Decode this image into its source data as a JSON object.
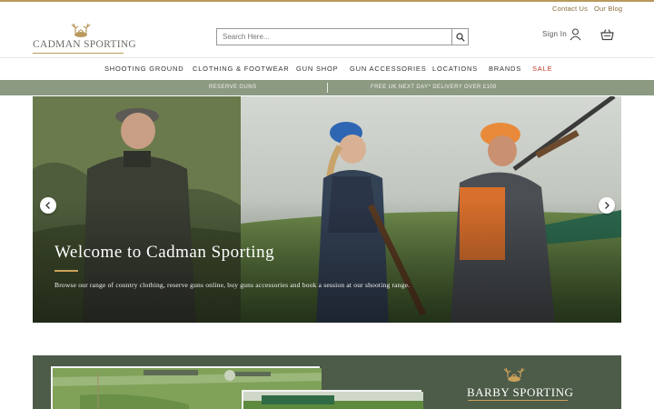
{
  "top_links": {
    "contact": "Contact Us",
    "blog": "Our Blog"
  },
  "logo": {
    "text": "CADMAN SPORTING"
  },
  "search": {
    "placeholder": "Search Here..."
  },
  "account": {
    "sign_in": "Sign In"
  },
  "nav": {
    "items": [
      "SHOOTING GROUND",
      "CLOTHING & FOOTWEAR",
      "GUN SHOP",
      "GUN ACCESSORIES",
      "LOCATIONS",
      "BRANDS",
      "SALE"
    ]
  },
  "promo": {
    "left": "RESERVE GUNS",
    "right": "FREE UK NEXT DAY* DELIVERY OVER £100"
  },
  "hero": {
    "title": "Welcome to Cadman Sporting",
    "text": "Browse our range of country clothing, reserve guns online, buy guns accessories and book a session at our shooting range."
  },
  "feature": {
    "brand": "BARBY SPORTING"
  },
  "colors": {
    "accent": "#b89a5e",
    "promo_bar": "#8d9a82",
    "feature_bg": "#4d5b49",
    "sale": "#c0392b"
  },
  "icons": {
    "search": "search-icon",
    "user": "user-icon",
    "basket": "basket-icon",
    "prev": "chevron-left-icon",
    "next": "chevron-right-icon"
  }
}
